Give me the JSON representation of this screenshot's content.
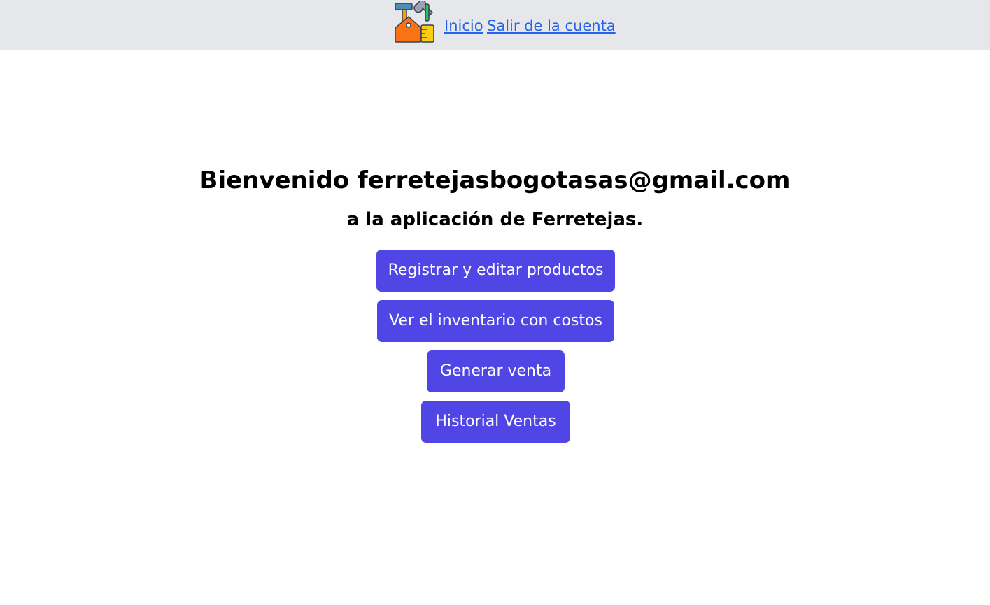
{
  "header": {
    "logo_icon": "hardware-toolbox-logo",
    "nav": [
      {
        "label": "Inicio"
      },
      {
        "label": "Salir de la cuenta"
      }
    ],
    "link_color": "#2563eb",
    "background_color": "#e5e7eb"
  },
  "main": {
    "title": "Bienvenido ferretejasbogotasas@gmail.com",
    "subtitle": "a la aplicación de Ferretejas.",
    "buttons": [
      {
        "label": "Registrar y editar productos"
      },
      {
        "label": "Ver el inventario con costos"
      },
      {
        "label": "Generar venta"
      },
      {
        "label": "Historial Ventas"
      }
    ],
    "button_color": "#4f46e5"
  }
}
